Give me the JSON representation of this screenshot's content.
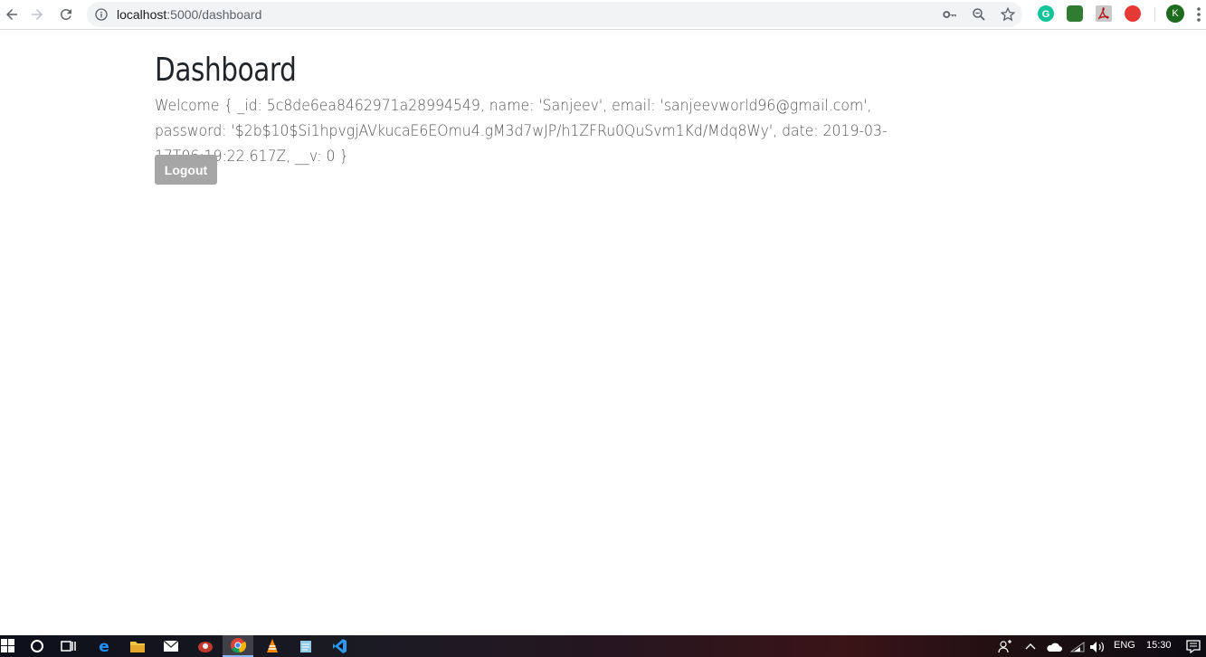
{
  "browser": {
    "url_host": "localhost",
    "url_path": ":5000/dashboard",
    "avatar_initial": "K"
  },
  "page": {
    "title": "Dashboard",
    "welcome_text": "Welcome { _id: 5c8de6ea8462971a28994549, name: 'Sanjeev', email: 'sanjeevworld96@gmail.com', password: '$2b$10$Si1hpvgjAVkucaE6EOmu4.gM3d7wJP/h1ZFRu0QuSvm1Kd/Mdq8Wy', date: 2019-03-17T06:19:22.617Z, __v: 0 }",
    "logout_label": "Logout"
  },
  "taskbar": {
    "language": "ENG",
    "time": "15:30"
  },
  "colors": {
    "logout_bg": "#a6a6a6",
    "avatar_bg": "#1e6b1e"
  }
}
